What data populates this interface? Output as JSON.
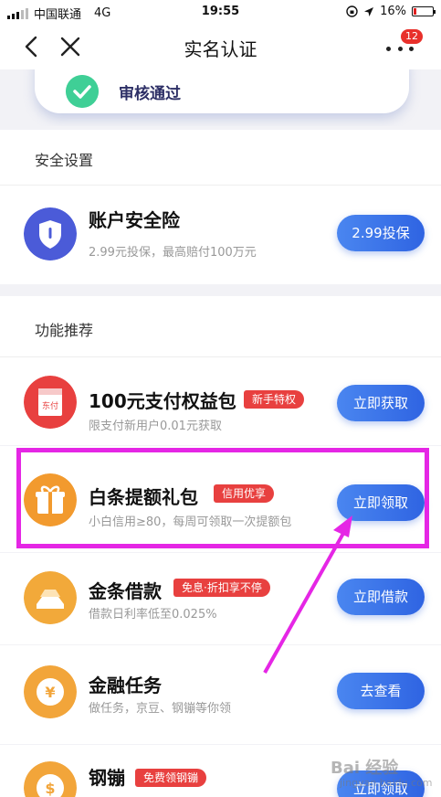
{
  "status_bar": {
    "carrier": "中国联通",
    "network": "4G",
    "time": "19:55",
    "battery": "16%"
  },
  "nav": {
    "title": "实名认证",
    "badge_count": "12"
  },
  "verify": {
    "status_text": "审核通过"
  },
  "security_section": {
    "title": "安全设置",
    "items": [
      {
        "name": "账户安全险",
        "desc": "2.99元投保，最高赔付100万元",
        "button": "2.99投保",
        "icon": "shield-icon"
      }
    ]
  },
  "recommend_section": {
    "title": "功能推荐",
    "items": [
      {
        "name": "100元支付权益包",
        "tag": "新手特权",
        "desc": "限支付新用户0.01元获取",
        "button": "立即获取",
        "icon": "payment-card-icon",
        "icon_text": "东付",
        "color": "#e8403f"
      },
      {
        "name": "白条提额礼包",
        "tag": "信用优享",
        "desc": "小白信用≥80，每周可领取一次提额包",
        "button": "立即领取",
        "icon": "gift-icon",
        "color": "#f29a2e"
      },
      {
        "name": "金条借款",
        "tag": "免息·折扣享不停",
        "desc": "借款日利率低至0.025%",
        "button": "立即借款",
        "icon": "gold-bar-icon",
        "color": "#f2a93a"
      },
      {
        "name": "金融任务",
        "desc": "做任务，京豆、钢镚等你领",
        "button": "去查看",
        "icon": "yen-coin-icon",
        "icon_text": "¥",
        "color": "#f2a53a"
      },
      {
        "name": "钢镚",
        "tag": "免费领钢镚",
        "desc": "",
        "button": "立即领取",
        "icon": "coin-icon",
        "color": "#f2a53a"
      }
    ]
  },
  "watermark": {
    "text": "Bai 经验",
    "sub": "jingyan.baidu.com"
  },
  "colors": {
    "accent": "#2f64e2",
    "tag_red": "#e8403f",
    "highlight": "#e526e5"
  }
}
